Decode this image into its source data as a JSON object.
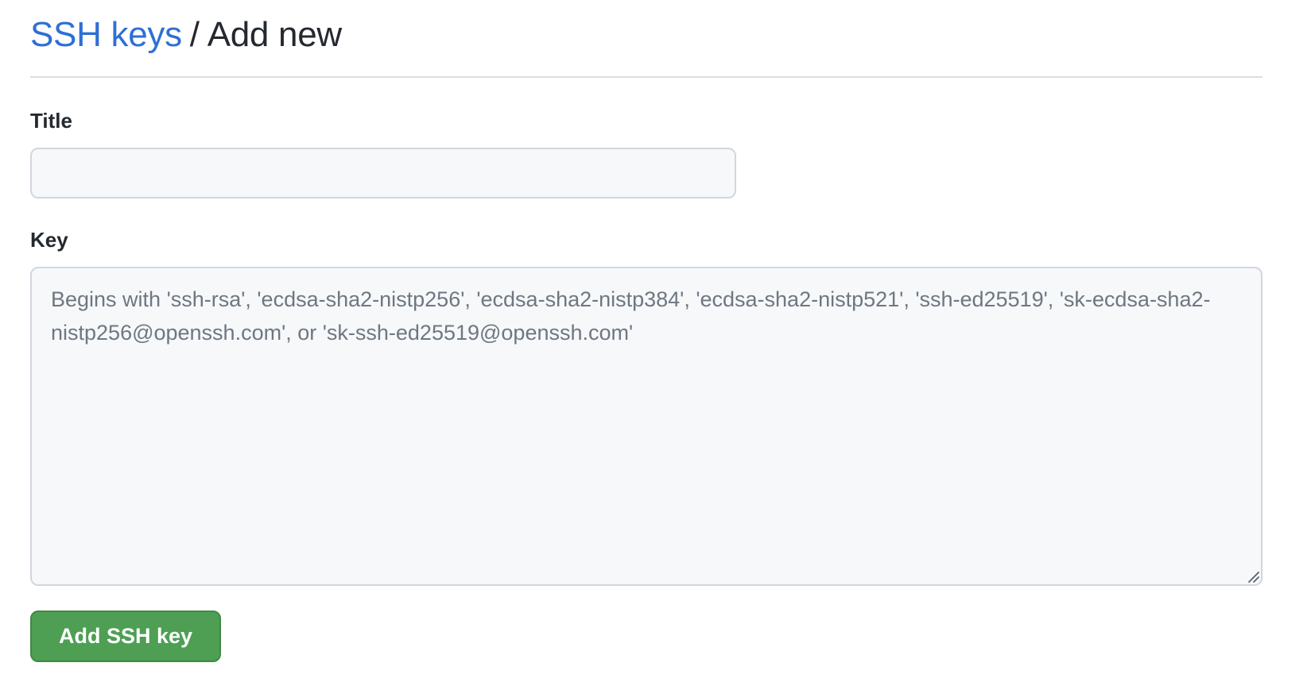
{
  "breadcrumb": {
    "parent_label": "SSH keys",
    "separator": "/",
    "current_label": "Add new"
  },
  "form": {
    "title": {
      "label": "Title",
      "value": "",
      "placeholder": ""
    },
    "key": {
      "label": "Key",
      "value": "",
      "placeholder": "Begins with 'ssh-rsa', 'ecdsa-sha2-nistp256', 'ecdsa-sha2-nistp384', 'ecdsa-sha2-nistp521', 'ssh-ed25519', 'sk-ecdsa-sha2-nistp256@openssh.com', or 'sk-ssh-ed25519@openssh.com'"
    },
    "submit_label": "Add SSH key"
  },
  "colors": {
    "link": "#2d6fd6",
    "primary_button": "#4e9f54",
    "input_background": "#f6f8fa",
    "border": "#d0d7de"
  },
  "icons": {
    "resize_handle": "resize-handle-icon"
  }
}
